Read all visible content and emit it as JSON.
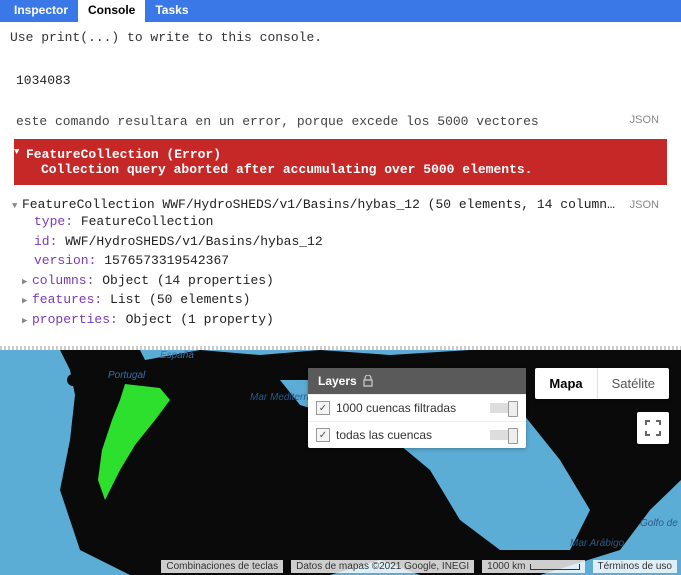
{
  "tabs": {
    "inspector": "Inspector",
    "console": "Console",
    "tasks": "Tasks"
  },
  "console": {
    "hint": "Use print(...) to write to this console.",
    "output1": "1034083",
    "cmd2": "este comando resultara en un error, porque excede los 5000 vectores",
    "json_tag": "JSON",
    "error": {
      "title": "FeatureCollection (Error)",
      "body": "Collection query aborted after accumulating over 5000 elements."
    },
    "obj": {
      "header": "FeatureCollection WWF/HydroSHEDS/v1/Basins/hybas_12 (50 elements, 14 column…",
      "type_key": "type:",
      "type_val": " FeatureCollection",
      "id_key": "id:",
      "id_val": " WWF/HydroSHEDS/v1/Basins/hybas_12",
      "version_key": "version:",
      "version_val": " 1576573319542367",
      "columns_key": "columns:",
      "columns_val": " Object (14 properties)",
      "features_key": "features:",
      "features_val": " List (50 elements)",
      "properties_key": "properties:",
      "properties_val": " Object (1 property)"
    }
  },
  "map": {
    "layers_title": "Layers",
    "layer1": "1000 cuencas filtradas",
    "layer2": "todas las cuencas",
    "maptype_map": "Mapa",
    "maptype_sat": "Satélite",
    "attrib_keys": "Combinaciones de teclas",
    "attrib_data": "Datos de mapas ©2021 Google, INEGI",
    "attrib_scale": "1000 km",
    "attrib_terms": "Términos de uso",
    "label_espana": "España",
    "label_portugal": "Portugal",
    "label_med": "Mar\nMediterráneo",
    "label_arab": "Mar Arábigo",
    "label_bengal": "Golfo de\nBengala"
  }
}
